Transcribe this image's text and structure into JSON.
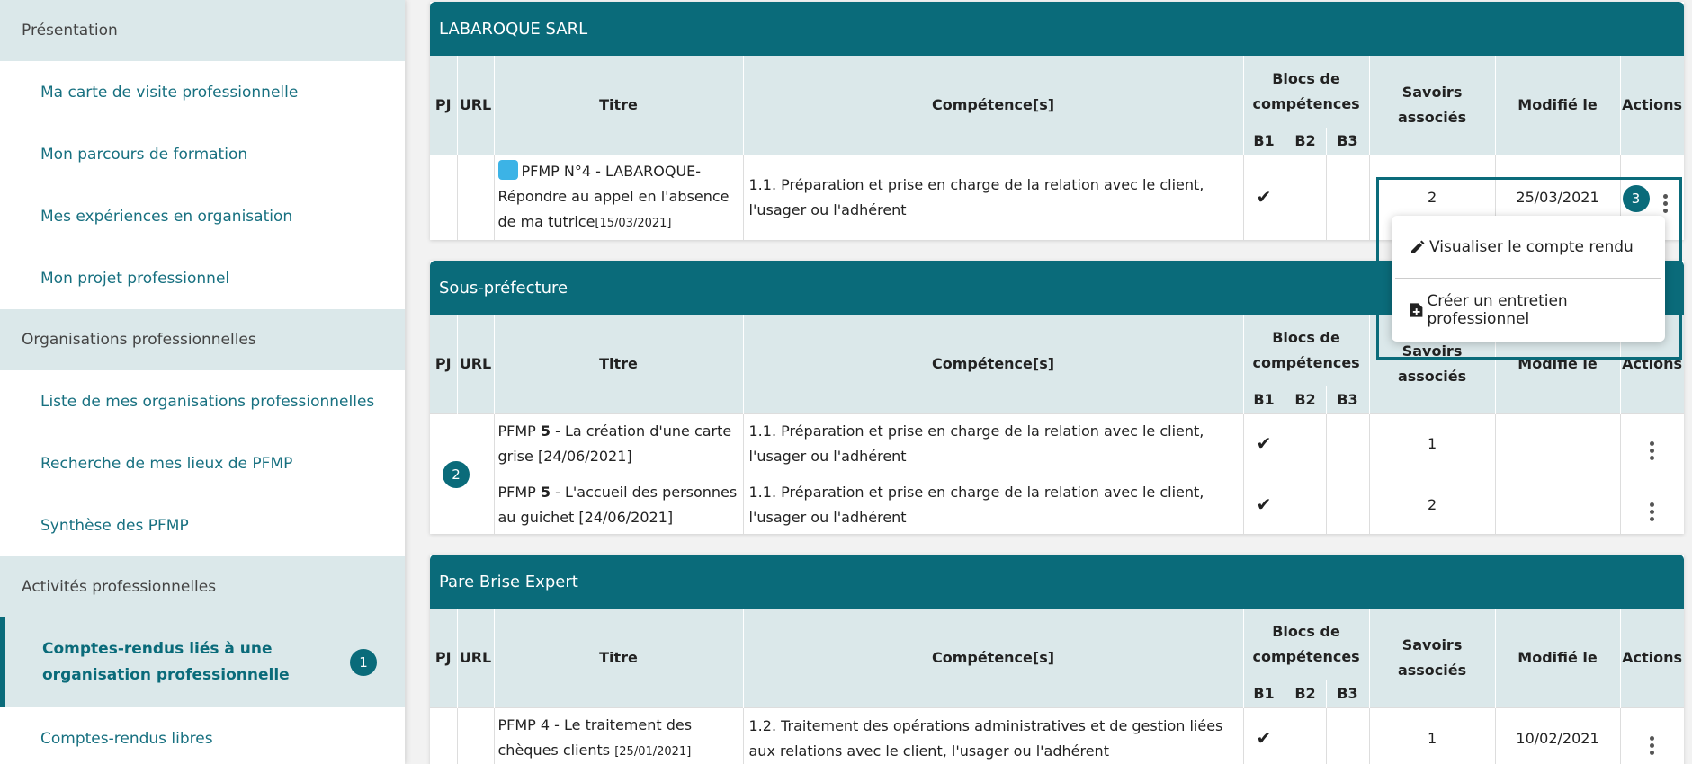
{
  "sidebar": {
    "sections": [
      {
        "title": "Présentation",
        "items": [
          "Ma carte de visite professionnelle",
          "Mon parcours de formation",
          "Mes expériences en organisation",
          "Mon projet professionnel"
        ]
      },
      {
        "title": "Organisations professionnelles",
        "items": [
          "Liste de mes organisations professionnelles",
          "Recherche de mes lieux de PFMP",
          "Synthèse des PFMP"
        ]
      },
      {
        "title": "Activités professionnelles",
        "items": [
          "Comptes-rendus liés à une organisation professionnelle",
          "Comptes-rendus libres"
        ]
      }
    ],
    "active_badge": "1"
  },
  "table_headers": {
    "pj": "PJ",
    "url": "URL",
    "titre": "Titre",
    "competences": "Compétence[s]",
    "blocs": "Blocs de compétences",
    "b1": "B1",
    "b2": "B2",
    "b3": "B3",
    "savoirs": "Savoirs associés",
    "modifie": "Modifié le",
    "actions": "Actions"
  },
  "cards": [
    {
      "name": "LABAROQUE SARL",
      "rows": [
        {
          "titre": "PFMP N°4 - LABAROQUE- Répondre au appel en l'absence de ma tutrice",
          "date": "[15/03/2021]",
          "competence": "1.1. Préparation et prise en charge de la relation avec le client, l'usager ou l'adhérent",
          "savoirs": "2",
          "modifie": "25/03/2021"
        }
      ],
      "badge": "3"
    },
    {
      "name": "Sous-préfecture",
      "rows": [
        {
          "titre_a": "PFMP ",
          "titre_num": "5",
          "titre_b": " - La création d'une carte grise [24/06/2021]",
          "competence": "1.1. Préparation et prise en charge de la relation avec le client, l'usager ou l'adhérent",
          "savoirs": "1",
          "modifie": ""
        },
        {
          "titre_a": "PFMP ",
          "titre_num": "5",
          "titre_b": " - L'accueil des personnes au guichet [24/06/2021]",
          "competence": "1.1. Préparation et prise en charge de la relation avec le client, l'usager ou l'adhérent",
          "savoirs": "2",
          "modifie": ""
        }
      ],
      "badge": "2"
    },
    {
      "name": "Pare Brise Expert",
      "rows": [
        {
          "titre": "PFMP 4 - Le traitement des chèques clients ",
          "date": "[25/01/2021]",
          "competence": "1.2. Traitement des opérations administratives et de gestion liées aux relations avec le client, l'usager ou l'adhérent",
          "savoirs": "1",
          "modifie": "10/02/2021"
        }
      ]
    }
  ],
  "menu": {
    "view_label": "Visualiser le compte rendu",
    "create_label": "Créer un entretien professionnel"
  },
  "colors": {
    "primary": "#0a6b7a",
    "header_bg": "#dbe8ea",
    "link": "#177080"
  }
}
